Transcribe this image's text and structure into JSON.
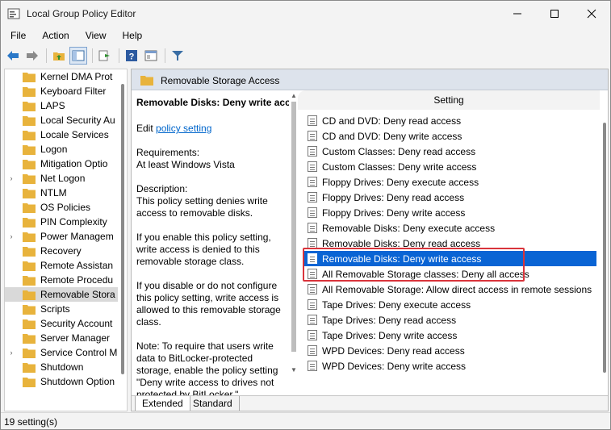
{
  "window": {
    "title": "Local Group Policy Editor"
  },
  "menu": [
    "File",
    "Action",
    "View",
    "Help"
  ],
  "tree": {
    "items": [
      {
        "label": "Kernel DMA Prot",
        "expandable": false,
        "selected": false
      },
      {
        "label": "Keyboard Filter",
        "expandable": false,
        "selected": false
      },
      {
        "label": "LAPS",
        "expandable": false,
        "selected": false
      },
      {
        "label": "Local Security Au",
        "expandable": false,
        "selected": false
      },
      {
        "label": "Locale Services",
        "expandable": false,
        "selected": false
      },
      {
        "label": "Logon",
        "expandable": false,
        "selected": false
      },
      {
        "label": "Mitigation Optio",
        "expandable": false,
        "selected": false
      },
      {
        "label": "Net Logon",
        "expandable": true,
        "selected": false
      },
      {
        "label": "NTLM",
        "expandable": false,
        "selected": false
      },
      {
        "label": "OS Policies",
        "expandable": false,
        "selected": false
      },
      {
        "label": "PIN Complexity",
        "expandable": false,
        "selected": false
      },
      {
        "label": "Power Managem",
        "expandable": true,
        "selected": false
      },
      {
        "label": "Recovery",
        "expandable": false,
        "selected": false
      },
      {
        "label": "Remote Assistan",
        "expandable": false,
        "selected": false
      },
      {
        "label": "Remote Procedu",
        "expandable": false,
        "selected": false
      },
      {
        "label": "Removable Stora",
        "expandable": false,
        "selected": true
      },
      {
        "label": "Scripts",
        "expandable": false,
        "selected": false
      },
      {
        "label": "Security Account",
        "expandable": false,
        "selected": false
      },
      {
        "label": "Server Manager",
        "expandable": false,
        "selected": false
      },
      {
        "label": "Service Control M",
        "expandable": true,
        "selected": false
      },
      {
        "label": "Shutdown",
        "expandable": false,
        "selected": false
      },
      {
        "label": "Shutdown Option",
        "expandable": false,
        "selected": false
      }
    ]
  },
  "header": {
    "folder_title": "Removable Storage Access"
  },
  "description": {
    "title": "Removable Disks: Deny write access",
    "edit_prefix": "Edit ",
    "edit_link": "policy setting",
    "requirements_label": "Requirements:",
    "requirements_value": "At least Windows Vista",
    "description_label": "Description:",
    "description_text": "This policy setting denies write access to removable disks.",
    "enable_text": "If you enable this policy setting, write access is denied to this removable storage class.",
    "disable_text": "If you disable or do not configure this policy setting, write access is allowed to this removable storage class.",
    "note_text": "Note: To require that users write data to BitLocker-protected storage, enable the policy setting \"Deny write access to drives not protected by BitLocker,\""
  },
  "list": {
    "column_header": "Setting",
    "items": [
      {
        "label": "CD and DVD: Deny read access",
        "selected": false
      },
      {
        "label": "CD and DVD: Deny write access",
        "selected": false
      },
      {
        "label": "Custom Classes: Deny read access",
        "selected": false
      },
      {
        "label": "Custom Classes: Deny write access",
        "selected": false
      },
      {
        "label": "Floppy Drives: Deny execute access",
        "selected": false
      },
      {
        "label": "Floppy Drives: Deny read access",
        "selected": false
      },
      {
        "label": "Floppy Drives: Deny write access",
        "selected": false
      },
      {
        "label": "Removable Disks: Deny execute access",
        "selected": false
      },
      {
        "label": "Removable Disks: Deny read access",
        "selected": false
      },
      {
        "label": "Removable Disks: Deny write access",
        "selected": true
      },
      {
        "label": "All Removable Storage classes: Deny all access",
        "selected": false
      },
      {
        "label": "All Removable Storage: Allow direct access in remote sessions",
        "selected": false
      },
      {
        "label": "Tape Drives: Deny execute access",
        "selected": false
      },
      {
        "label": "Tape Drives: Deny read access",
        "selected": false
      },
      {
        "label": "Tape Drives: Deny write access",
        "selected": false
      },
      {
        "label": "WPD Devices: Deny read access",
        "selected": false
      },
      {
        "label": "WPD Devices: Deny write access",
        "selected": false
      }
    ]
  },
  "tabs": {
    "extended": "Extended",
    "standard": "Standard"
  },
  "status": {
    "text": "19 setting(s)"
  },
  "colors": {
    "selection": "#0a64d4",
    "highlight_box": "#d9343b",
    "link": "#0066cc",
    "folder": "#e8b33c"
  }
}
